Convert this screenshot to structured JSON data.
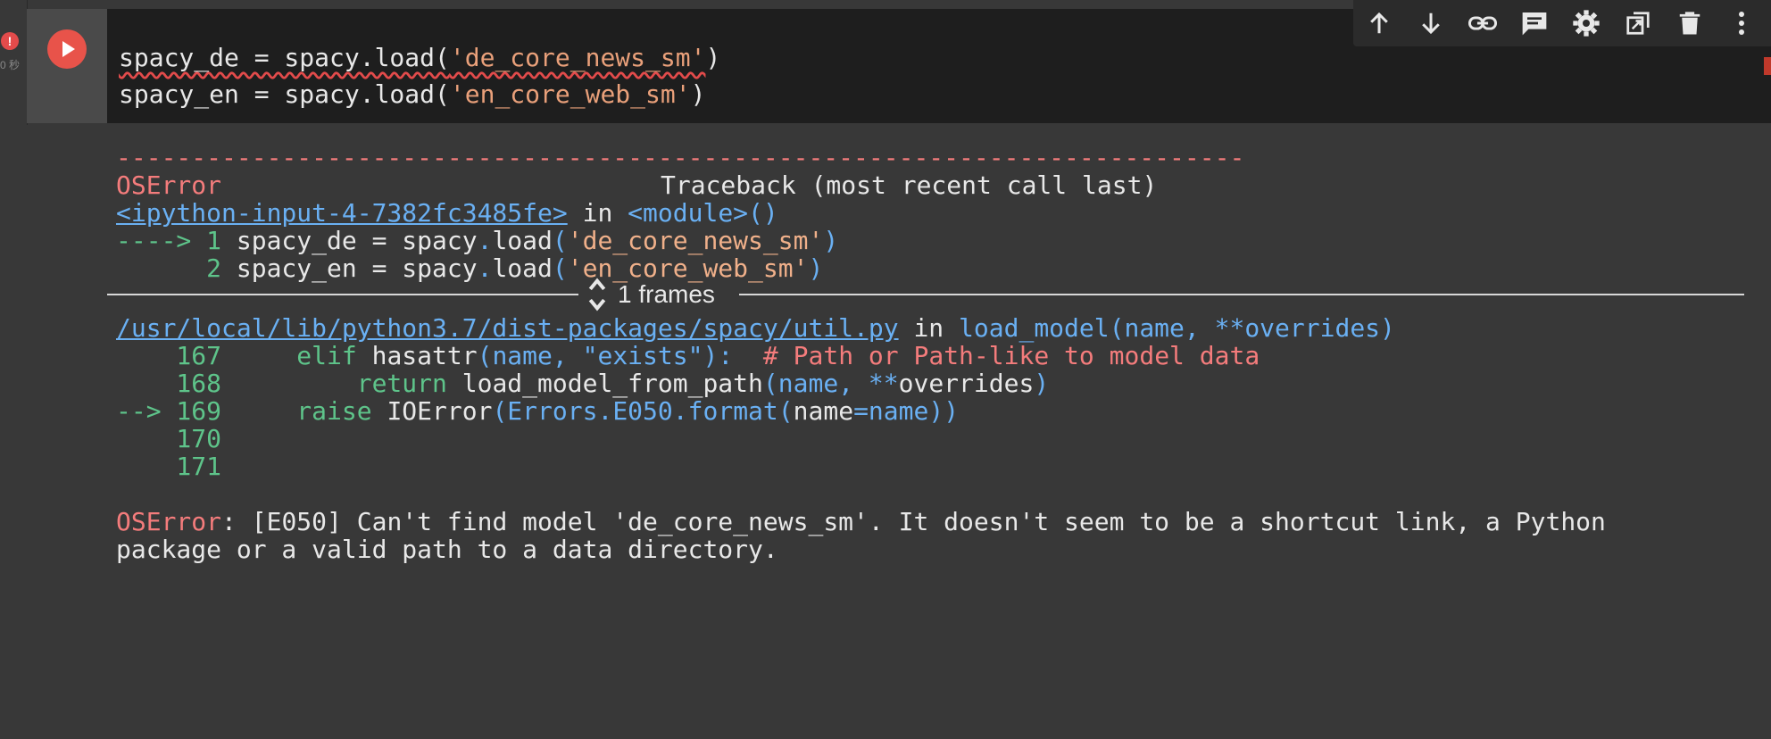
{
  "gutter": {
    "error_icon": "!",
    "error_sub": "0 秒"
  },
  "cell": {
    "code_lines": [
      {
        "pre": "spacy_de = spacy.load(",
        "str": "'de_core_news_sm'",
        "post": ")"
      },
      {
        "pre": "spacy_en = spacy.load(",
        "str": "'en_core_web_sm'",
        "post": ")"
      }
    ]
  },
  "toolbar": {
    "icons": [
      "arrow-up-icon",
      "arrow-down-icon",
      "link-icon",
      "comment-icon",
      "gear-icon",
      "mirror-cell-icon",
      "trash-icon",
      "more-vert-icon"
    ]
  },
  "output": {
    "dash_line": "---------------------------------------------------------------------------",
    "err_name": "OSError",
    "traceback_label": "Traceback (most recent call last)",
    "input_link": "<ipython-input-4-7382fc3485fe>",
    "in_word": " in ",
    "module": "<module>()",
    "arrow1": "----> 1 ",
    "line1_pre": "spacy_de = spacy",
    "dot": ".",
    "load": "load",
    "paren_open": "(",
    "line1_str": "'de_core_news_sm'",
    "paren_close": ")",
    "num2": "      2 ",
    "line2_pre": "spacy_en = spacy",
    "line2_str": "'en_core_web_sm'",
    "frames_label": "1 frames",
    "util_link": "/usr/local/lib/python3.7/dist-packages/spacy/util.py",
    "load_model_sig": "load_model(name, **overrides)",
    "l167_num": "    167     ",
    "l167_kw": "elif",
    "l167_mid": " hasattr",
    "l167_args": "(name, ",
    "l167_str": "\"exists\"",
    "l167_close": "):  ",
    "l167_comment": "# Path or Path-like to model data",
    "l168_num": "    168         ",
    "l168_kw": "return",
    "l168_mid": " load_model_from_path",
    "l168_args": "(name, **",
    "l168_tail": "overrides",
    "l168_close": ")",
    "l169_num": "--> 169     ",
    "l169_kw": "raise",
    "l169_mid": " IOError",
    "l169_a": "(Errors",
    "l169_b": ".E050.",
    "l169_c": "format(",
    "l169_d": "name",
    "l169_e": "=name",
    "l169_f": "))",
    "l170_num": "    170",
    "l171_num": "    171",
    "final_err": "OSError",
    "final_msg1": ": [E050] Can't find model 'de_core_news_sm'. It doesn't seem to be a shortcut link, a Python",
    "final_msg2": "package or a valid path to a data directory."
  }
}
